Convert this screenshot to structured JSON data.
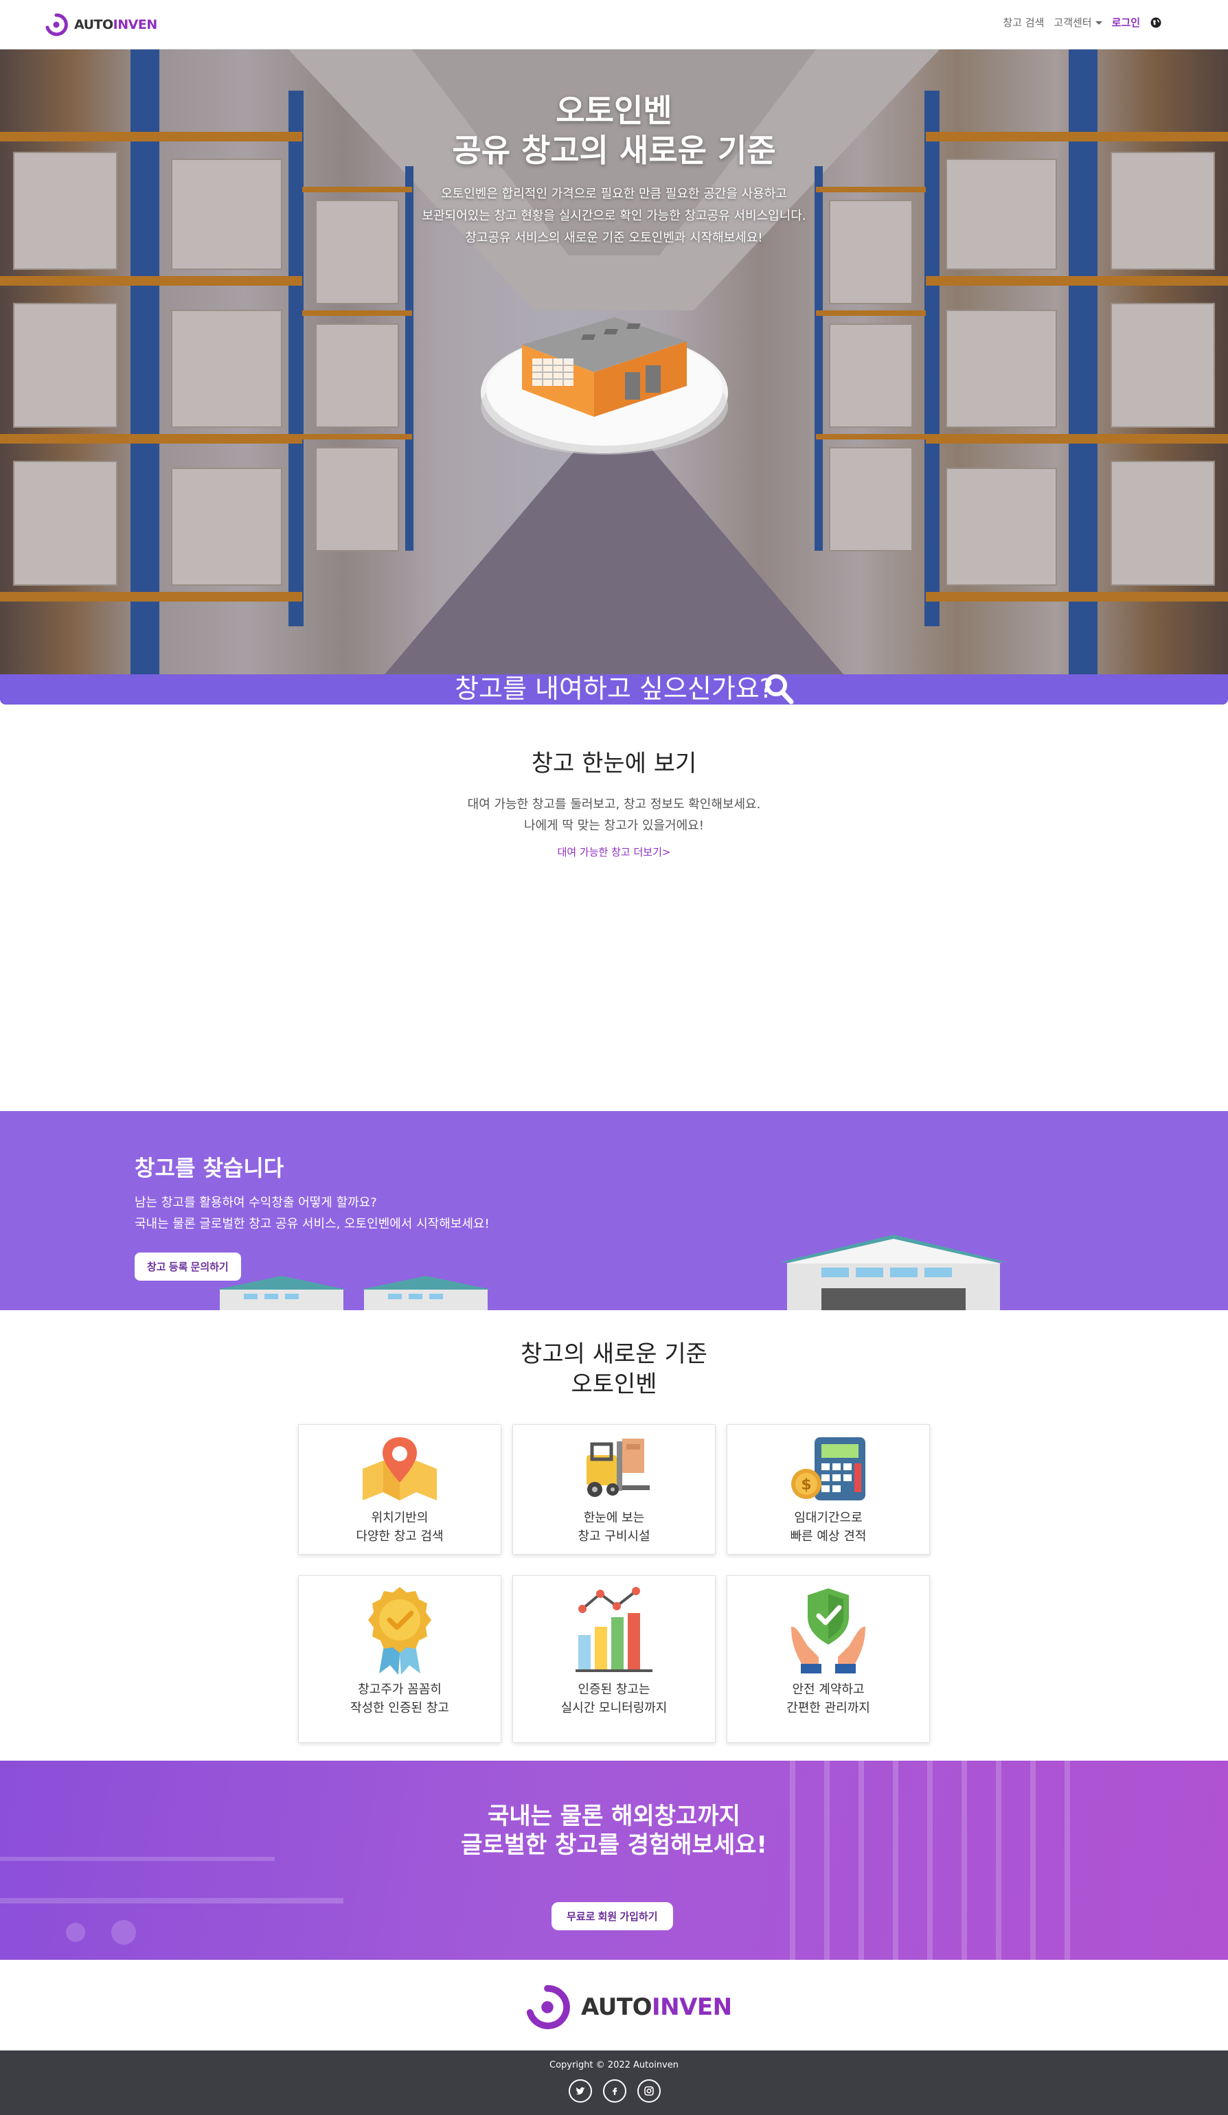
{
  "nav": {
    "brand_a": "AUTO",
    "brand_b": "INVEN",
    "search": "창고 검색",
    "support": "고객센터",
    "login": "로그인",
    "globe_icon": "globe-icon"
  },
  "hero": {
    "title_line1": "오토인벤",
    "title_line2": "공유 창고의 새로운 기준",
    "desc_line1": "오토인벤은 합리적인 가격으로 필요한 만큼 필요한 공간을 사용하고",
    "desc_line2": "보관되어있는 창고 현황을 실시간으로 확인 가능한 창고공유 서비스입니다.",
    "desc_line3": "창고공유 서비스의 새로운 기준 오토인벤과 시작해보세요!"
  },
  "search_banner": {
    "text": "창고를 내여하고 싶으신가요?",
    "icon": "search-icon"
  },
  "overview": {
    "title": "창고 한눈에 보기",
    "desc_line1": "대여 가능한 창고를 둘러보고, 창고 정보도 확인해보세요.",
    "desc_line2": "나에게 딱 맞는 창고가 있을거에요!",
    "link": "대여 가능한 창고 더보기>"
  },
  "find": {
    "title": "창고를 찾습니다",
    "desc_line1": "남는 창고를 활용하여 수익창출 어떻게 할까요?",
    "desc_line2": "국내는 물론 글로벌한 창고 공유 서비스, 오토인벤에서 시작해보세요!",
    "button": "창고 등록 문의하기"
  },
  "features": {
    "title_line1": "창고의 새로운 기준",
    "title_line2": "오토인벤",
    "items": [
      {
        "line1": "위치기반의",
        "line2": "다양한 창고 검색",
        "icon": "map-pin-icon"
      },
      {
        "line1": "한눈에 보는",
        "line2": "창고 구비시설",
        "icon": "forklift-icon"
      },
      {
        "line1": "임대기간으로",
        "line2": "빠른 예상 견적",
        "icon": "calculator-icon"
      },
      {
        "line1": "창고주가 꼼꼼히",
        "line2": "작성한 인증된 창고",
        "icon": "badge-icon"
      },
      {
        "line1": "인증된 창고는",
        "line2": "실시간 모니터링까지",
        "icon": "bar-chart-icon"
      },
      {
        "line1": "안전 계약하고",
        "line2": "간편한 관리까지",
        "icon": "shield-hands-icon"
      }
    ]
  },
  "cta": {
    "title_line1": "국내는 물론 해외창고까지",
    "title_line2": "글로벌한 창고를 경험해보세요!",
    "button": "무료로 회원 가입하기"
  },
  "footer": {
    "brand_a": "AUTO",
    "brand_b": "INVEN",
    "copyright": "Copyright © 2022 Autoinven",
    "socials": [
      "twitter-icon",
      "facebook-icon",
      "instagram-icon"
    ]
  },
  "colors": {
    "brand_purple": "#8e2fbf",
    "banner_purple": "#7a5fe0",
    "section_purple": "#9065e2",
    "footer_dark": "#3d3d44"
  }
}
